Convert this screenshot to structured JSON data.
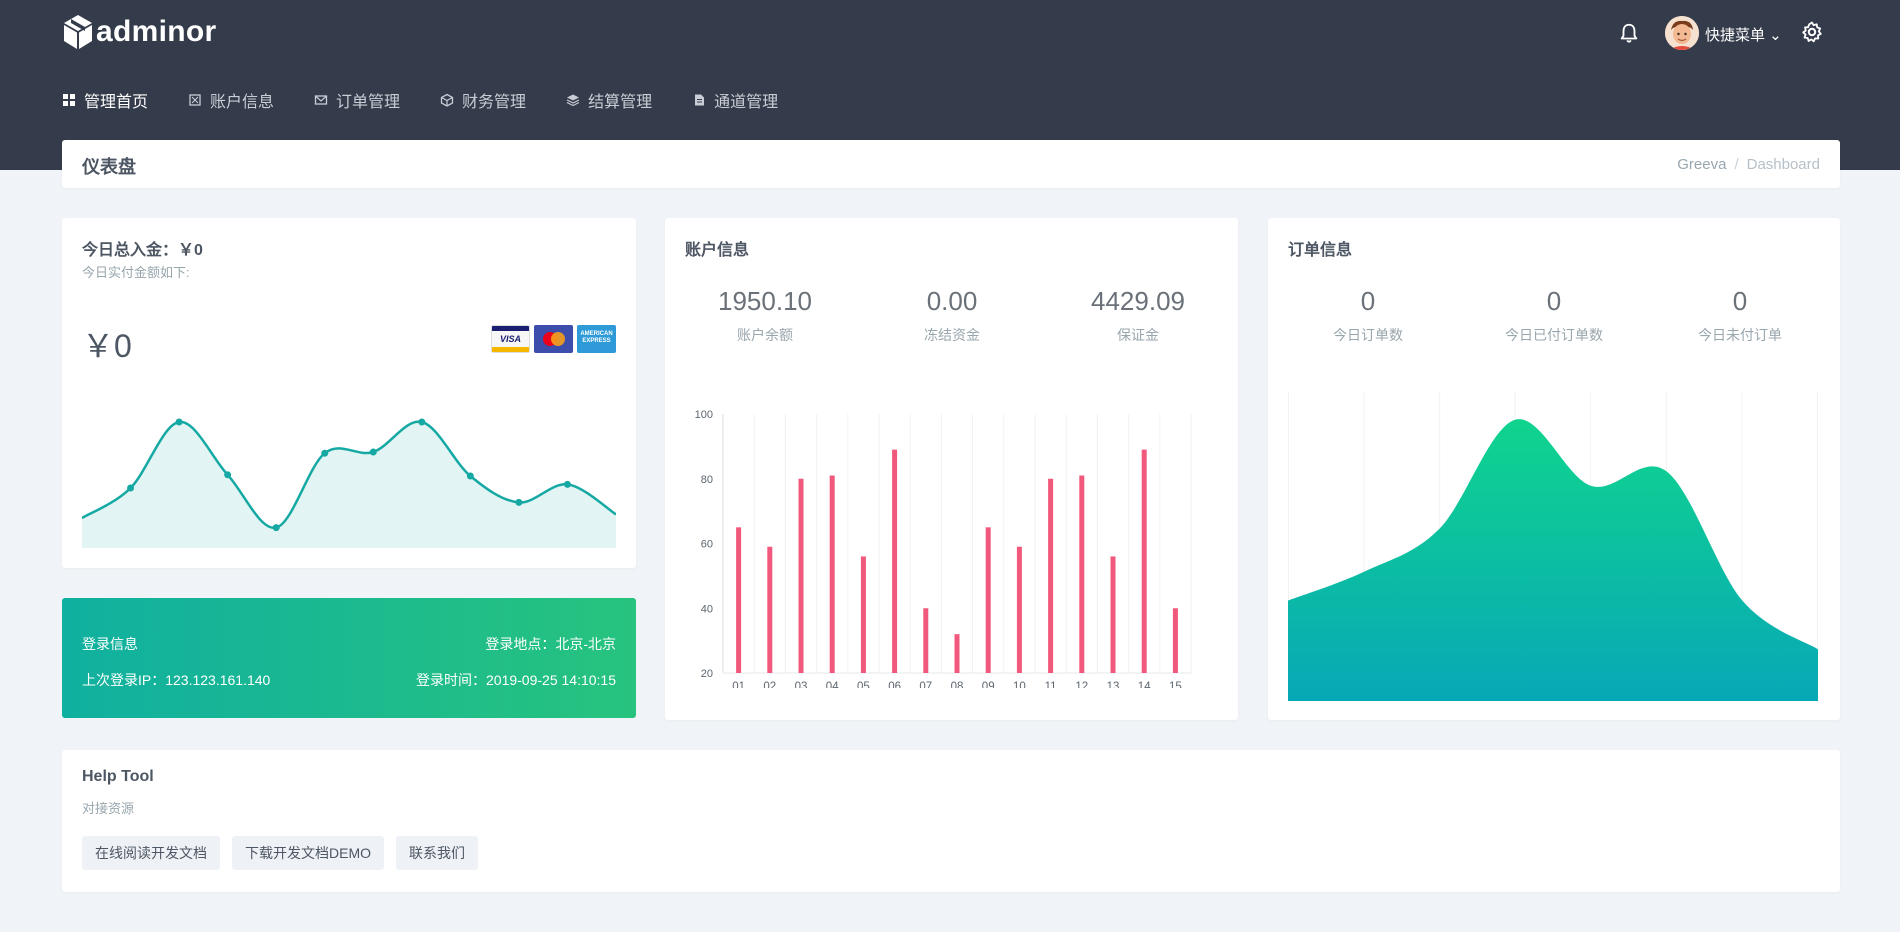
{
  "brand": {
    "name": "adminor"
  },
  "header": {
    "quick_menu_label": "快捷菜单 ⌄"
  },
  "nav": [
    {
      "label": "管理首页",
      "icon": "dashboard-icon",
      "active": true
    },
    {
      "label": "账户信息",
      "icon": "account-icon",
      "active": false
    },
    {
      "label": "订单管理",
      "icon": "mail-icon",
      "active": false
    },
    {
      "label": "财务管理",
      "icon": "cube-icon",
      "active": false
    },
    {
      "label": "结算管理",
      "icon": "layers-icon",
      "active": false
    },
    {
      "label": "通道管理",
      "icon": "file-icon",
      "active": false
    }
  ],
  "page": {
    "title": "仪表盘",
    "breadcrumb": [
      "Greeva",
      "Dashboard"
    ],
    "breadcrumb_sep": "/"
  },
  "income": {
    "title": "今日总入金：￥0",
    "subtitle": "今日实付金额如下:",
    "amount": "￥0",
    "cards": [
      "VISA",
      "MasterCard",
      "AMERICAN EXPRESS"
    ]
  },
  "login": {
    "title": "登录信息",
    "location": "登录地点：北京-北京",
    "last_ip": "上次登录IP：123.123.161.140",
    "time": "登录时间：2019-09-25 14:10:15"
  },
  "account": {
    "title": "账户信息",
    "stats": [
      {
        "value": "1950.10",
        "label": "账户余额"
      },
      {
        "value": "0.00",
        "label": "冻结资金"
      },
      {
        "value": "4429.09",
        "label": "保证金"
      }
    ]
  },
  "order": {
    "title": "订单信息",
    "stats": [
      {
        "value": "0",
        "label": "今日订单数"
      },
      {
        "value": "0",
        "label": "今日已付订单数"
      },
      {
        "value": "0",
        "label": "今日未付订单"
      }
    ]
  },
  "help": {
    "title": "Help Tool",
    "subtitle": "对接资源",
    "buttons": [
      "在线阅读开发文档",
      "下载开发文档DEMO",
      "联系我们"
    ]
  },
  "colors": {
    "topbar": "#343b4a",
    "spark_line": "#16a9a4",
    "bar": "#f1597c",
    "area_top": "#10d48e",
    "area_bottom": "#07a8b6"
  },
  "chart_data": [
    {
      "type": "line",
      "values": [
        20,
        45,
        100,
        56,
        12,
        74,
        75,
        100,
        55,
        33,
        48,
        23
      ],
      "grid": false
    },
    {
      "type": "bar",
      "categories": [
        "01",
        "02",
        "03",
        "04",
        "05",
        "06",
        "07",
        "08",
        "09",
        "10",
        "11",
        "12",
        "13",
        "14",
        "15"
      ],
      "values": [
        65,
        59,
        80,
        81,
        56,
        89,
        40,
        32,
        65,
        59,
        80,
        81,
        56,
        89,
        40
      ],
      "ylim": [
        20,
        100
      ],
      "yticks": [
        20,
        40,
        60,
        80,
        100
      ]
    },
    {
      "type": "area",
      "values": [
        35,
        45,
        60,
        98,
        75,
        80,
        35,
        18
      ],
      "grid": true
    }
  ]
}
